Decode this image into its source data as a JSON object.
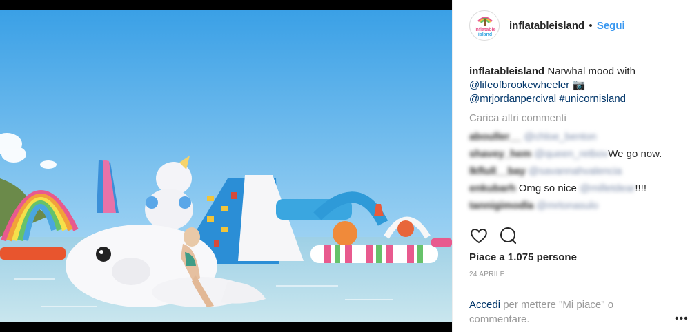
{
  "post": {
    "username": "inflatableisland",
    "separator": "•",
    "follow_label": "Segui",
    "avatar_text_top": "inflatable",
    "avatar_text_bottom": "island"
  },
  "caption": {
    "username": "inflatableisland",
    "text": "Narwhal mood with",
    "mention1": "@lifeofbrookewheeler",
    "camera_emoji": "📷",
    "mention2": "@mrjordanpercival",
    "hashtag": "#unicornisland"
  },
  "load_more_label": "Carica altri commenti",
  "comments": [
    {
      "user": "abouller__",
      "handle": "@chloe_benton",
      "text": ""
    },
    {
      "user": "shavey_hem",
      "handle": "@queen_retbov",
      "text": "We go now."
    },
    {
      "user": "lkflull__bay",
      "handle": "@savannahvalencia",
      "text": ""
    },
    {
      "user": "enkubarh",
      "handle": "",
      "text": "Omg so nice",
      "handle2": "@milletdear",
      "tail": "!!!!"
    },
    {
      "user": "tannigimodla",
      "handle": "@mrtonasulo",
      "text": ""
    }
  ],
  "actions": {
    "like_icon": "heart-icon",
    "comment_icon": "comment-icon"
  },
  "likes_text": "Piace a 1.075 persone",
  "date": "24 APRILE",
  "login": {
    "link": "Accedi",
    "rest": "per mettere \"Mi piace\" o commentare."
  },
  "more_label": "•••",
  "colors": {
    "link": "#003569",
    "follow": "#3897f0",
    "muted": "#999999",
    "sky": "#5fb6ec",
    "water": "#8fc4dc"
  }
}
